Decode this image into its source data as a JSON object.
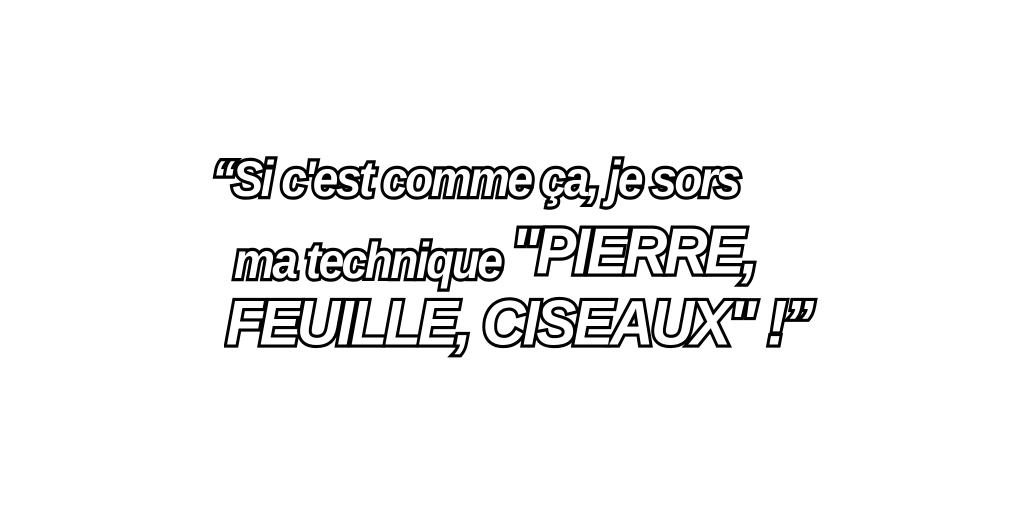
{
  "quote": {
    "line1": "“Si c'est comme ça, je sors",
    "line2_prefix": "ma technique ",
    "line2_emphasis": "\"PIERRE,",
    "line3": "FEUILLE, CISEAUX\" !”"
  }
}
